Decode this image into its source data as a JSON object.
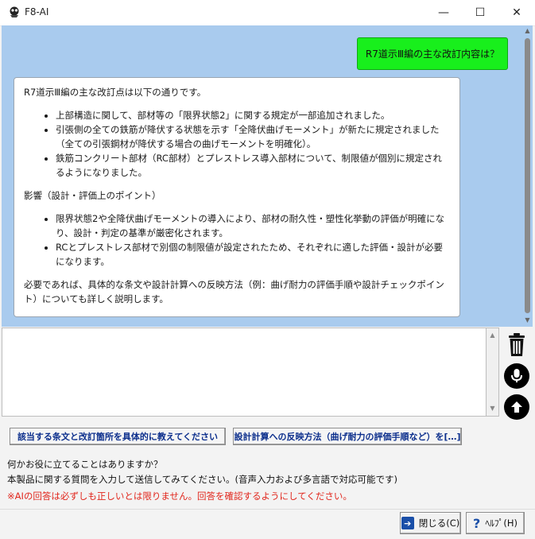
{
  "window": {
    "title": "F8-AI",
    "minimize_glyph": "—",
    "maximize_glyph": "☐",
    "close_glyph": "✕"
  },
  "chat": {
    "user_message": "R7道示Ⅲ編の主な改訂内容は？",
    "ai_intro": "R7道示Ⅲ編の主な改訂点は以下の通りです。",
    "ai_points": [
      "上部構造に関して、部材等の「限界状態2」に関する規定が一部追加されました。",
      "引張側の全ての鉄筋が降伏する状態を示す「全降伏曲げモーメント」が新たに規定されました（全ての引張鋼材が降伏する場合の曲げモーメントを明確化）。",
      "鉄筋コンクリート部材（RC部材）とプレストレス導入部材について、制限値が個別に規定されるようになりました。"
    ],
    "ai_impact_heading": "影響（設計・評価上のポイント）",
    "ai_impact_points": [
      "限界状態2や全降伏曲げモーメントの導入により、部材の耐久性・塑性化挙動の評価が明確になり、設計・判定の基準が厳密化されます。",
      "RCとプレストレス部材で別個の制限値が設定されたため、それぞれに適した評価・設計が必要になります。"
    ],
    "ai_closing": "必要であれば、具体的な条文や設計計算への反映方法（例：曲げ耐力の評価手順や設計チェックポイント）についても詳しく説明します。"
  },
  "input": {
    "value": "",
    "placeholder": ""
  },
  "icons": {
    "trash": "trash-icon",
    "mic": "microphone-icon",
    "send": "send-arrow-up-icon",
    "exit": "exit-icon",
    "help": "help-icon"
  },
  "suggestions": [
    "該当する条文と改訂箇所を具体的に教えてください",
    "設計計算への反映方法（曲げ耐力の評価手順など）を[…]"
  ],
  "info": {
    "line1": "何かお役に立てることはありますか？",
    "line2": "本製品に関する質問を入力して送信してみてください。(音声入力および多言語で対応可能です)",
    "warning": "※AIの回答は必ずしも正しいとは限りません。回答を確認するようにしてください。"
  },
  "buttons": {
    "close_label": "閉じる(C)",
    "help_label": "ﾍﾙﾌﾟ(H)"
  },
  "colors": {
    "chat_background": "#a9cbee",
    "user_bubble": "#18ef1c",
    "warning_text": "#e1261c",
    "suggestion_text": "#0b2e8c"
  }
}
